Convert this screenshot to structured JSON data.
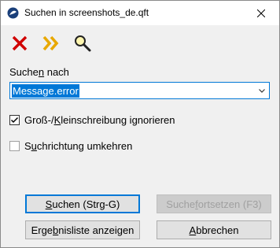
{
  "window": {
    "title": "Suchen in screenshots_de.qft",
    "close_glyph": "✕"
  },
  "toolbar": {
    "items": [
      {
        "icon": "red-x-icon",
        "color": "#d00000"
      },
      {
        "icon": "double-chevron-right-icon",
        "color": "#e8a800"
      },
      {
        "icon": "magnifier-icon",
        "color": "#000000"
      }
    ]
  },
  "search": {
    "label_pre": "Suche",
    "label_accel": "n",
    "label_post": " nach",
    "value": "Message.error"
  },
  "options": {
    "case_insensitive": {
      "checked": true,
      "label_pre": "Groß-/",
      "label_accel": "K",
      "label_post": "leinschreibung ignorieren"
    },
    "reverse": {
      "checked": false,
      "label_pre": "S",
      "label_accel": "u",
      "label_post": "chrichtung umkehren"
    }
  },
  "buttons": {
    "search": {
      "pre": "",
      "accel": "S",
      "post": "uchen (Strg-G)"
    },
    "continue": {
      "pre": "Suche ",
      "accel": "f",
      "post": "ortsetzen (F3)",
      "disabled": true
    },
    "results": {
      "pre": "Erge",
      "accel": "b",
      "post": "nisliste anzeigen"
    },
    "cancel": {
      "pre": "",
      "accel": "A",
      "post": "bbrechen"
    }
  },
  "colors": {
    "accent": "#0078d7",
    "window_bg": "#f0f0f0"
  }
}
